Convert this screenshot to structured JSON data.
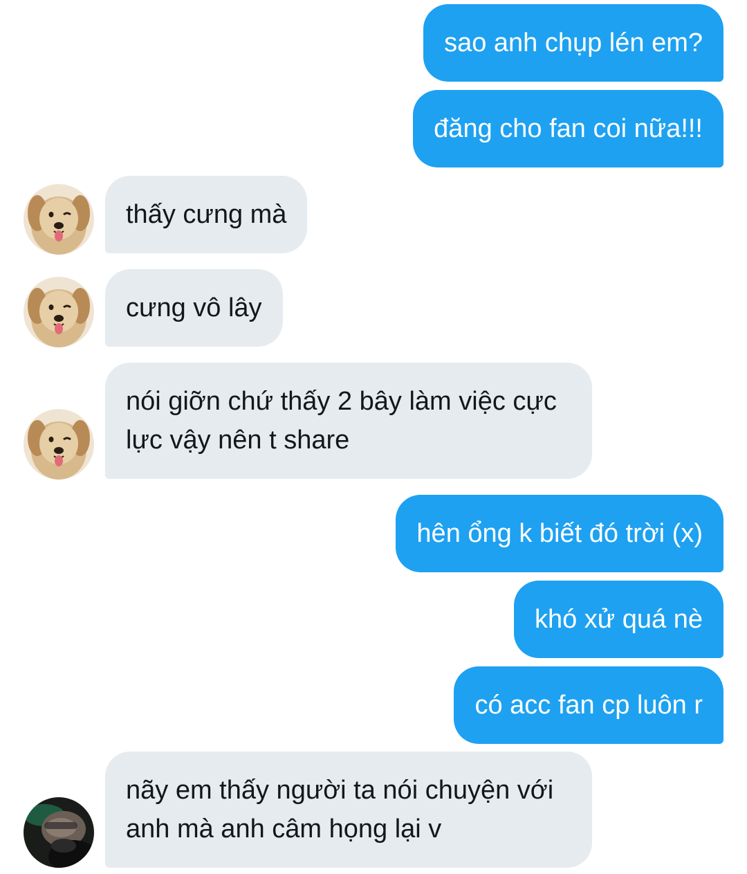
{
  "messages": [
    {
      "side": "out",
      "text": "sao anh chụp lén em?"
    },
    {
      "side": "out",
      "text": "đăng cho fan coi nữa!!!"
    },
    {
      "side": "in",
      "text": "thấy cưng mà",
      "avatar": "golden-retriever-avatar"
    },
    {
      "side": "in",
      "text": "cưng vô lây",
      "avatar": "golden-retriever-avatar"
    },
    {
      "side": "in",
      "lines": [
        "nói giỡn chứ thấy 2 bây làm việc cực",
        "lực vậy nên t share"
      ],
      "avatar": "golden-retriever-avatar"
    },
    {
      "side": "out",
      "text": "hên ổng k biết đó trời (x)"
    },
    {
      "side": "out",
      "text": "khó xử quá nè"
    },
    {
      "side": "out",
      "text": "có acc fan cp luôn r"
    },
    {
      "side": "in",
      "lines": [
        "nãy em thấy người ta nói chuyện với",
        "anh mà anh câm họng lại v"
      ],
      "avatar": "dark-person-avatar"
    }
  ],
  "colors": {
    "outgoing_bubble": "#1ea1f1",
    "incoming_bubble": "#e6ebef",
    "outgoing_text": "#ffffff",
    "incoming_text": "#14171a"
  }
}
